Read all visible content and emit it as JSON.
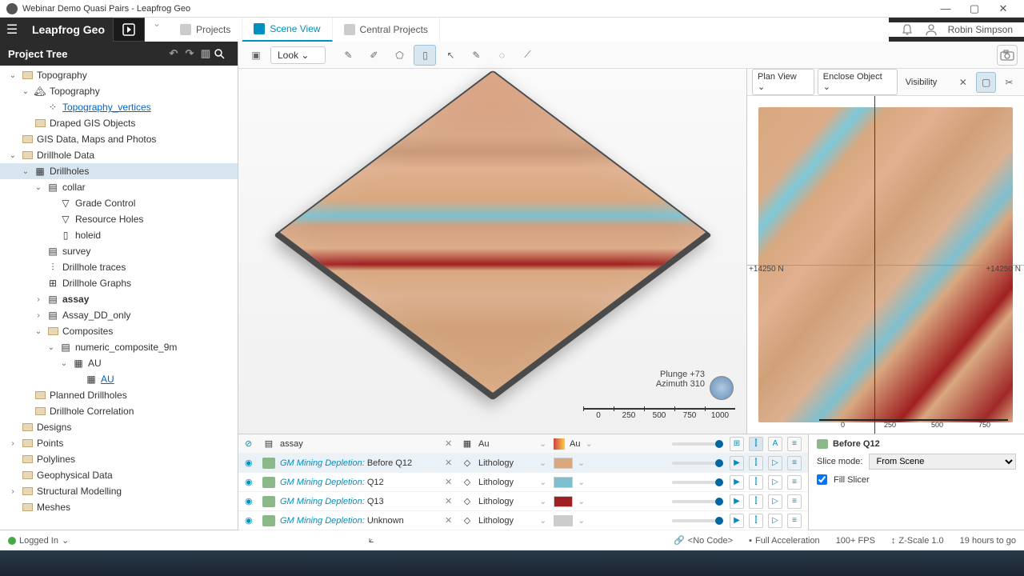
{
  "window": {
    "title": "Webinar Demo Quasi Pairs - Leapfrog Geo"
  },
  "app": {
    "name": "Leapfrog Geo"
  },
  "tabs": [
    {
      "label": "Projects"
    },
    {
      "label": "Scene View"
    },
    {
      "label": "Central Projects"
    }
  ],
  "user": {
    "name": "Robin Simpson"
  },
  "panel": {
    "title": "Project Tree"
  },
  "tree": {
    "topography": "Topography",
    "topography2": "Topography",
    "topo_vertices": "Topography_vertices",
    "draped": "Draped GIS Objects",
    "gis": "GIS Data, Maps and Photos",
    "drillhole_data": "Drillhole Data",
    "drillholes": "Drillholes",
    "collar": "collar",
    "grade_control": "Grade Control",
    "resource_holes": "Resource Holes",
    "holeid": "holeid",
    "survey": "survey",
    "traces": "Drillhole traces",
    "graphs": "Drillhole Graphs",
    "assay": "assay",
    "assay_dd": "Assay_DD_only",
    "composites": "Composites",
    "numeric_comp": "numeric_composite_9m",
    "au1": "AU",
    "au2": "AU",
    "planned": "Planned Drillholes",
    "correlation": "Drillhole Correlation",
    "designs": "Designs",
    "points": "Points",
    "polylines": "Polylines",
    "geophysical": "Geophysical Data",
    "structural": "Structural Modelling",
    "meshes": "Meshes"
  },
  "toolbar": {
    "look": "Look"
  },
  "view3d": {
    "plunge": "Plunge  +73",
    "azimuth": "Azimuth  310",
    "scale": [
      "0",
      "250",
      "500",
      "750",
      "1000"
    ]
  },
  "minimap": {
    "plan_view": "Plan View",
    "enclose": "Enclose Object",
    "visibility": "Visibility",
    "coord_left": "+14250 N",
    "coord_right": "+14250 N",
    "scale": [
      "0",
      "250",
      "500",
      "750"
    ]
  },
  "scene": {
    "filter1": "assay",
    "filter2": "Au",
    "filter3": "Au",
    "rows": [
      {
        "gm": "GM Mining Depletion:",
        "suffix": " Before Q12",
        "lith": "Lithology",
        "swatch": "#d8a880"
      },
      {
        "gm": "GM Mining Depletion:",
        "suffix": " Q12",
        "lith": "Lithology",
        "swatch": "#7ec0d0"
      },
      {
        "gm": "GM Mining Depletion:",
        "suffix": " Q13",
        "lith": "Lithology",
        "swatch": "#a02020"
      },
      {
        "gm": "GM Mining Depletion:",
        "suffix": " Unknown",
        "lith": "Lithology",
        "swatch": "#cccccc"
      }
    ],
    "side_title": "Before Q12",
    "slice_mode_label": "Slice mode:",
    "slice_mode": "From Scene",
    "fill_slicer": "Fill Slicer"
  },
  "status": {
    "logged_in": "Logged In",
    "no_code": "<No Code>",
    "accel": "Full Acceleration",
    "fps": "100+ FPS",
    "zscale": "Z-Scale 1.0",
    "timer": "19 hours to go"
  }
}
